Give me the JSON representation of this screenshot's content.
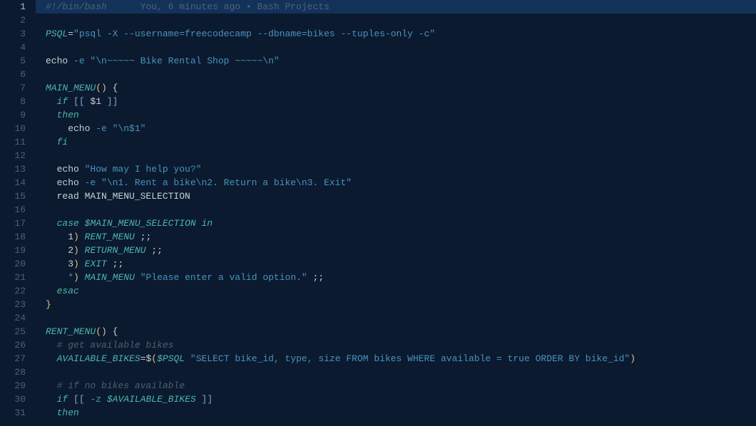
{
  "codelens_text": "You, 6 minutes ago • Bash Projects",
  "lines": [
    {
      "n": 1,
      "active": true,
      "hl": true,
      "tokens": [
        {
          "cls": "c-comment",
          "t": "#!/bin/bash"
        },
        {
          "cls": "c-lens",
          "t": "      "
        },
        {
          "cls": "c-lens",
          "t": "You, 6 minutes ago • Bash Projects"
        }
      ]
    },
    {
      "n": 2,
      "tokens": []
    },
    {
      "n": 3,
      "tokens": [
        {
          "cls": "c-var",
          "t": "PSQL"
        },
        {
          "cls": "c-op",
          "t": "="
        },
        {
          "cls": "c-str",
          "t": "\"psql -X --username=freecodecamp --dbname=bikes --tuples-only -c\""
        }
      ]
    },
    {
      "n": 4,
      "tokens": []
    },
    {
      "n": 5,
      "tokens": [
        {
          "cls": "c-plain",
          "t": "echo "
        },
        {
          "cls": "c-flag",
          "t": "-e "
        },
        {
          "cls": "c-str",
          "t": "\"\\n~~~~~ Bike Rental Shop ~~~~~\\n\""
        }
      ]
    },
    {
      "n": 6,
      "tokens": []
    },
    {
      "n": 7,
      "tokens": [
        {
          "cls": "c-func",
          "t": "MAIN_MENU"
        },
        {
          "cls": "c-yellow",
          "t": "()"
        },
        {
          "cls": "c-plain",
          "t": " {"
        }
      ]
    },
    {
      "n": 8,
      "tokens": [
        {
          "cls": "c-plain",
          "t": "  "
        },
        {
          "cls": "c-key",
          "t": "if"
        },
        {
          "cls": "c-plain",
          "t": " "
        },
        {
          "cls": "c-sqbr",
          "t": "[["
        },
        {
          "cls": "c-plain",
          "t": " $1 "
        },
        {
          "cls": "c-sqbr",
          "t": "]]"
        }
      ]
    },
    {
      "n": 9,
      "tokens": [
        {
          "cls": "c-plain",
          "t": "  "
        },
        {
          "cls": "c-key",
          "t": "then"
        }
      ]
    },
    {
      "n": 10,
      "tokens": [
        {
          "cls": "c-plain",
          "t": "    echo "
        },
        {
          "cls": "c-flag",
          "t": "-e "
        },
        {
          "cls": "c-str",
          "t": "\"\\n$1\""
        }
      ]
    },
    {
      "n": 11,
      "tokens": [
        {
          "cls": "c-plain",
          "t": "  "
        },
        {
          "cls": "c-key",
          "t": "fi"
        }
      ]
    },
    {
      "n": 12,
      "tokens": []
    },
    {
      "n": 13,
      "tokens": [
        {
          "cls": "c-plain",
          "t": "  echo "
        },
        {
          "cls": "c-str",
          "t": "\"How may I help you?\""
        }
      ]
    },
    {
      "n": 14,
      "tokens": [
        {
          "cls": "c-plain",
          "t": "  echo "
        },
        {
          "cls": "c-flag",
          "t": "-e "
        },
        {
          "cls": "c-str",
          "t": "\"\\n1. Rent a bike\\n2. Return a bike\\n3. Exit\""
        }
      ]
    },
    {
      "n": 15,
      "tokens": [
        {
          "cls": "c-plain",
          "t": "  read MAIN_MENU_SELECTION"
        }
      ]
    },
    {
      "n": 16,
      "tokens": []
    },
    {
      "n": 17,
      "tokens": [
        {
          "cls": "c-plain",
          "t": "  "
        },
        {
          "cls": "c-key",
          "t": "case"
        },
        {
          "cls": "c-plain",
          "t": " "
        },
        {
          "cls": "c-var",
          "t": "$MAIN_MENU_SELECTION"
        },
        {
          "cls": "c-plain",
          "t": " "
        },
        {
          "cls": "c-key",
          "t": "in"
        }
      ]
    },
    {
      "n": 18,
      "tokens": [
        {
          "cls": "c-plain",
          "t": "    1"
        },
        {
          "cls": "c-yellow",
          "t": ")"
        },
        {
          "cls": "c-plain",
          "t": " "
        },
        {
          "cls": "c-var",
          "t": "RENT_MENU"
        },
        {
          "cls": "c-plain",
          "t": " ;;"
        }
      ]
    },
    {
      "n": 19,
      "tokens": [
        {
          "cls": "c-plain",
          "t": "    2"
        },
        {
          "cls": "c-yellow",
          "t": ")"
        },
        {
          "cls": "c-plain",
          "t": " "
        },
        {
          "cls": "c-var",
          "t": "RETURN_MENU"
        },
        {
          "cls": "c-plain",
          "t": " ;;"
        }
      ]
    },
    {
      "n": 20,
      "tokens": [
        {
          "cls": "c-plain",
          "t": "    3"
        },
        {
          "cls": "c-yellow",
          "t": ")"
        },
        {
          "cls": "c-plain",
          "t": " "
        },
        {
          "cls": "c-var",
          "t": "EXIT"
        },
        {
          "cls": "c-plain",
          "t": " ;;"
        }
      ]
    },
    {
      "n": 21,
      "tokens": [
        {
          "cls": "c-plain",
          "t": "    "
        },
        {
          "cls": "c-case",
          "t": "*"
        },
        {
          "cls": "c-yellow",
          "t": ")"
        },
        {
          "cls": "c-plain",
          "t": " "
        },
        {
          "cls": "c-var",
          "t": "MAIN_MENU"
        },
        {
          "cls": "c-plain",
          "t": " "
        },
        {
          "cls": "c-str",
          "t": "\"Please enter a valid option.\""
        },
        {
          "cls": "c-plain",
          "t": " ;;"
        }
      ]
    },
    {
      "n": 22,
      "tokens": [
        {
          "cls": "c-plain",
          "t": "  "
        },
        {
          "cls": "c-key",
          "t": "esac"
        }
      ]
    },
    {
      "n": 23,
      "tokens": [
        {
          "cls": "c-yellow",
          "t": "}"
        }
      ]
    },
    {
      "n": 24,
      "tokens": []
    },
    {
      "n": 25,
      "tokens": [
        {
          "cls": "c-func",
          "t": "RENT_MENU"
        },
        {
          "cls": "c-yellow",
          "t": "()"
        },
        {
          "cls": "c-plain",
          "t": " {"
        }
      ]
    },
    {
      "n": 26,
      "tokens": [
        {
          "cls": "c-plain",
          "t": "  "
        },
        {
          "cls": "c-comment",
          "t": "# get available bikes"
        }
      ]
    },
    {
      "n": 27,
      "tokens": [
        {
          "cls": "c-plain",
          "t": "  "
        },
        {
          "cls": "c-var",
          "t": "AVAILABLE_BIKES"
        },
        {
          "cls": "c-op",
          "t": "="
        },
        {
          "cls": "c-plain",
          "t": "$"
        },
        {
          "cls": "c-yellow",
          "t": "("
        },
        {
          "cls": "c-var",
          "t": "$PSQL"
        },
        {
          "cls": "c-plain",
          "t": " "
        },
        {
          "cls": "c-str",
          "t": "\"SELECT bike_id, type, size FROM bikes WHERE available = true ORDER BY bike_id\""
        },
        {
          "cls": "c-yellow",
          "t": ")"
        }
      ]
    },
    {
      "n": 28,
      "tokens": []
    },
    {
      "n": 29,
      "tokens": [
        {
          "cls": "c-plain",
          "t": "  "
        },
        {
          "cls": "c-comment",
          "t": "# if no bikes available"
        }
      ]
    },
    {
      "n": 30,
      "tokens": [
        {
          "cls": "c-plain",
          "t": "  "
        },
        {
          "cls": "c-key",
          "t": "if"
        },
        {
          "cls": "c-plain",
          "t": " "
        },
        {
          "cls": "c-sqbr",
          "t": "[["
        },
        {
          "cls": "c-plain",
          "t": " "
        },
        {
          "cls": "c-flag",
          "t": "-z"
        },
        {
          "cls": "c-plain",
          "t": " "
        },
        {
          "cls": "c-var",
          "t": "$AVAILABLE_BIKES"
        },
        {
          "cls": "c-plain",
          "t": " "
        },
        {
          "cls": "c-sqbr",
          "t": "]]"
        }
      ]
    },
    {
      "n": 31,
      "tokens": [
        {
          "cls": "c-plain",
          "t": "  "
        },
        {
          "cls": "c-key",
          "t": "then"
        }
      ]
    }
  ]
}
